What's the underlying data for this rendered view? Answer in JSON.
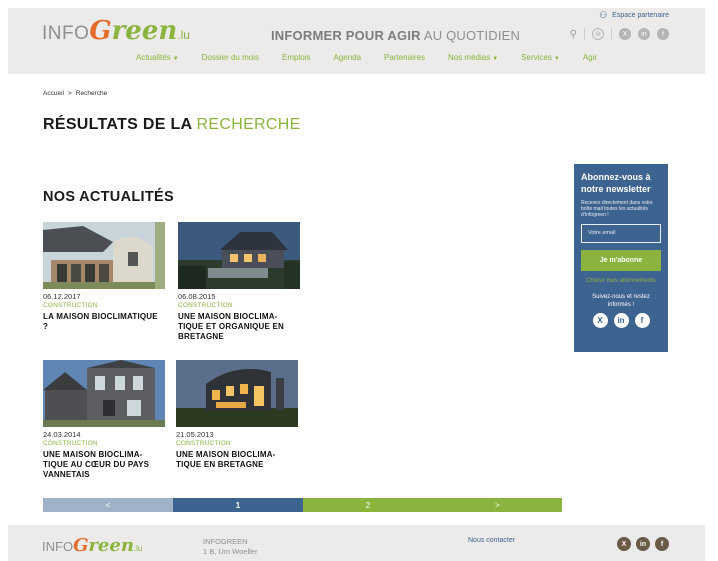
{
  "header": {
    "partner_label": "Espace partenaire",
    "logo": {
      "info": "INFO",
      "g": "G",
      "reen": "reen",
      "lu": ".lu"
    },
    "tagline_bold": "INFORMER POUR AGIR",
    "tagline_rest": " AU QUOTIDIEN",
    "nav": [
      {
        "label": "Actualités",
        "dropdown": true
      },
      {
        "label": "Dossier du mois",
        "dropdown": false
      },
      {
        "label": "Emplois",
        "dropdown": false
      },
      {
        "label": "Agenda",
        "dropdown": false
      },
      {
        "label": "Partenaires",
        "dropdown": false
      },
      {
        "label": "Nos médias",
        "dropdown": true
      },
      {
        "label": "Services",
        "dropdown": true
      },
      {
        "label": "Agir",
        "dropdown": false
      }
    ]
  },
  "breadcrumb": {
    "home": "Accueil",
    "sep": ">",
    "current": "Recherche"
  },
  "page_title": {
    "main": "RÉSULTATS DE LA ",
    "accent": "RECHERCHE"
  },
  "section_title": "NOS ACTUALITÉS",
  "articles": [
    {
      "date": "06.12.2017",
      "category": "CONSTRUCTION",
      "title": "LA MAISON BIOCLIMATIQUE ?"
    },
    {
      "date": "06.08.2015",
      "category": "CONSTRUCTION",
      "title": "UNE MAISON BIOCLIMA-TIQUE ET ORGANIQUE EN BRETAGNE"
    },
    {
      "date": "24.03.2014",
      "category": "CONSTRUCTION",
      "title": "UNE MAISON BIOCLIMA-TIQUE AU CŒUR DU PAYS VANNETAIS"
    },
    {
      "date": "21.05.2013",
      "category": "CONSTRUCTION",
      "title": "UNE MAISON BIOCLIMA-TIQUE EN BRETAGNE"
    }
  ],
  "newsletter": {
    "heading": "Abonnez-vous à notre newsletter",
    "description": "Recevez directement dans votre boîte mail toutes les actualités d'Infogreen !",
    "email_placeholder": "Votre email",
    "subscribe_label": "Je m'abonne",
    "choose_label": "Choisir mes abonnements",
    "follow_label": "Suivez-nous et restez informés !"
  },
  "pagination": {
    "prev": "<",
    "page1": "1",
    "page2": "2",
    "next": ">"
  },
  "footer": {
    "company": "INFOGREEN",
    "address": "1 B, Um Woeller",
    "contact_label": "Nous contacter"
  },
  "colors": {
    "green": "#8ab43e",
    "blue": "#3d6390",
    "orange": "#e36c2b",
    "header_bg": "#ecebe9"
  },
  "icons": [
    "user-group-icon",
    "search-icon",
    "rss-icon",
    "x-icon",
    "linkedin-icon",
    "facebook-icon"
  ]
}
